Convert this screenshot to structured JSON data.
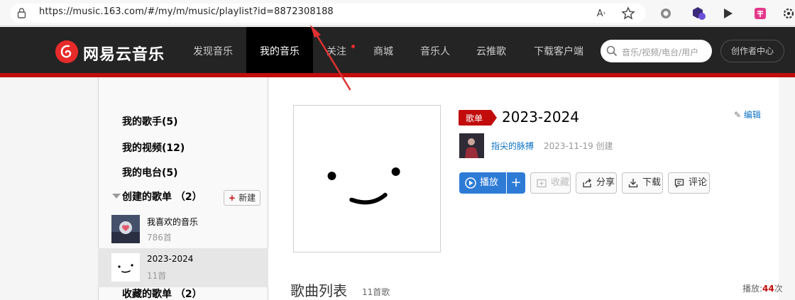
{
  "browser": {
    "url": "https://music.163.com/#/my/m/music/playlist?id=8872308188",
    "icons": [
      "lock-icon",
      "read-aloud-icon",
      "favorite-star-icon",
      "extension-circle-icon",
      "extension-hex-icon",
      "extension-play-icon",
      "extension-pink-icon",
      "settings-gear-icon"
    ]
  },
  "topnav": {
    "logo_text": "网易云音乐",
    "items": [
      "发现音乐",
      "我的音乐",
      "关注",
      "商城",
      "音乐人",
      "云推歌",
      "下载客户端"
    ],
    "active_index": 1,
    "search_placeholder": "音乐/视频/电台/用户",
    "creator_center": "创作者中心"
  },
  "sidebar": {
    "my_singers": "我的歌手(5)",
    "my_videos": "我的视频(12)",
    "my_radio": "我的电台(5)",
    "created_header": "创建的歌单 （2）",
    "new_button": "新建",
    "playlists": [
      {
        "name": "我喜欢的音乐",
        "count": "786首"
      },
      {
        "name": "2023-2024",
        "count": "11首"
      }
    ],
    "selected_index": 1,
    "collected_header": "收藏的歌单 （2）"
  },
  "playlist": {
    "tag": "歌单",
    "title": "2023-2024",
    "creator": "指尖的脉搏",
    "created": "2023-11-19 创建",
    "edit": "编辑",
    "buttons": {
      "play": "播放",
      "add": "+",
      "collect": "收藏",
      "share": "分享",
      "download": "下载",
      "comment": "评论"
    }
  },
  "songlist": {
    "title": "歌曲列表",
    "count": "11首歌",
    "play_label": "播放:",
    "play_count": "44",
    "play_unit": "次"
  },
  "colors": {
    "brand_red": "#c20c0c",
    "nav_bg": "#242424",
    "play_blue": "#2e7bd6",
    "link_blue": "#0c73c2",
    "annotation_arrow": "#e03131"
  }
}
